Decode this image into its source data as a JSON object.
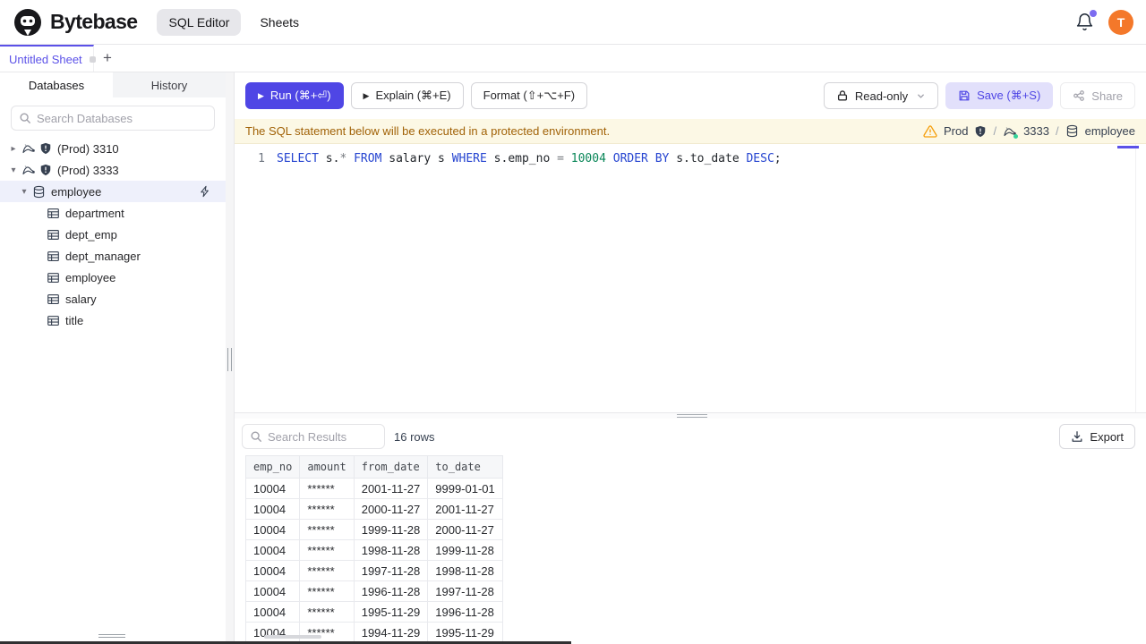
{
  "colors": {
    "accent": "#4f46e5",
    "active_tab": "#5b51e8",
    "banner_bg": "#fcf8e5",
    "banner_text": "#a16207",
    "avatar_bg": "#f4782a",
    "warning": "#f59e0b",
    "sql_keyword": "#2544d0",
    "sql_number": "#098658",
    "selected_row_bg": "#eef0fb"
  },
  "brand": {
    "name": "Bytebase"
  },
  "header": {
    "nav_sql_editor": "SQL Editor",
    "nav_sheets": "Sheets",
    "avatar_letter": "T"
  },
  "tabs": {
    "sheet_title": "Untitled Sheet",
    "add_label": "+"
  },
  "sidebar": {
    "tab_databases": "Databases",
    "tab_history": "History",
    "search_placeholder": "Search Databases",
    "tree": {
      "instances": [
        {
          "label": "(Prod) 3310",
          "expanded": false,
          "icon": "mysql-icon",
          "env_icon": "shield-icon",
          "databases": []
        },
        {
          "label": "(Prod) 3333",
          "expanded": true,
          "icon": "mysql-icon",
          "env_icon": "shield-icon",
          "databases": [
            {
              "name": "employee",
              "selected": true,
              "icon": "database-icon",
              "action_icon": "lightning-icon",
              "tables": [
                "department",
                "dept_emp",
                "dept_manager",
                "employee",
                "salary",
                "title"
              ]
            }
          ]
        }
      ]
    }
  },
  "toolbar": {
    "run_label": "Run (⌘+⏎)",
    "explain_label": "Explain (⌘+E)",
    "format_label": "Format (⇧+⌥+F)",
    "readonly_label": "Read-only",
    "save_label": "Save (⌘+S)",
    "share_label": "Share"
  },
  "banner": {
    "message": "The SQL statement below will be executed in a protected environment.",
    "environment": "Prod",
    "instance": "3333",
    "database": "employee",
    "separator": "/"
  },
  "editor": {
    "line_number": "1",
    "sql_text": "SELECT s.* FROM salary s WHERE s.emp_no = 10004 ORDER BY s.to_date DESC;",
    "tokens": [
      {
        "text": "SELECT",
        "type": "kw"
      },
      {
        "text": " s.",
        "type": "id"
      },
      {
        "text": "*",
        "type": "op"
      },
      {
        "text": " ",
        "type": "id"
      },
      {
        "text": "FROM",
        "type": "kw"
      },
      {
        "text": " salary s ",
        "type": "id"
      },
      {
        "text": "WHERE",
        "type": "kw"
      },
      {
        "text": " s.emp_no ",
        "type": "id"
      },
      {
        "text": "=",
        "type": "op"
      },
      {
        "text": " ",
        "type": "id"
      },
      {
        "text": "10004",
        "type": "num"
      },
      {
        "text": " ",
        "type": "id"
      },
      {
        "text": "ORDER",
        "type": "kw"
      },
      {
        "text": " ",
        "type": "id"
      },
      {
        "text": "BY",
        "type": "kw"
      },
      {
        "text": " s.to_date ",
        "type": "id"
      },
      {
        "text": "DESC",
        "type": "kw"
      },
      {
        "text": ";",
        "type": "id"
      }
    ]
  },
  "results": {
    "search_placeholder": "Search Results",
    "row_count": "16 rows",
    "export_label": "Export",
    "columns": [
      "emp_no",
      "amount",
      "from_date",
      "to_date"
    ],
    "rows": [
      [
        "10004",
        "******",
        "2001-11-27",
        "9999-01-01"
      ],
      [
        "10004",
        "******",
        "2000-11-27",
        "2001-11-27"
      ],
      [
        "10004",
        "******",
        "1999-11-28",
        "2000-11-27"
      ],
      [
        "10004",
        "******",
        "1998-11-28",
        "1999-11-28"
      ],
      [
        "10004",
        "******",
        "1997-11-28",
        "1998-11-28"
      ],
      [
        "10004",
        "******",
        "1996-11-28",
        "1997-11-28"
      ],
      [
        "10004",
        "******",
        "1995-11-29",
        "1996-11-28"
      ],
      [
        "10004",
        "******",
        "1994-11-29",
        "1995-11-29"
      ]
    ]
  }
}
